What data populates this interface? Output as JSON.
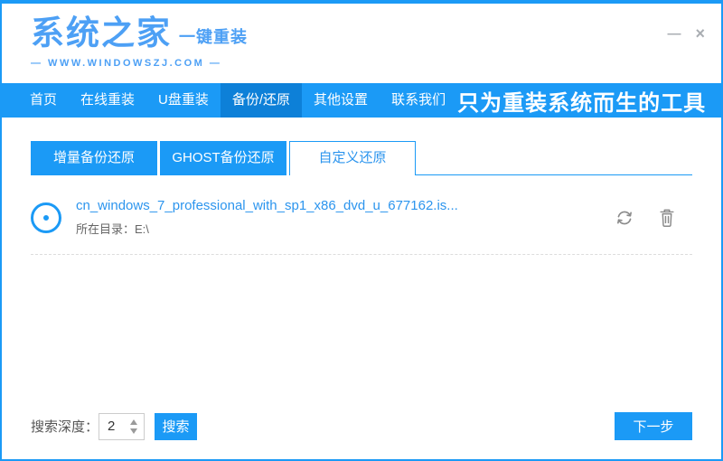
{
  "window": {
    "minimize_glyph": "—",
    "close_glyph": "×"
  },
  "header": {
    "logo_text": "系统之家",
    "logo_subtitle": "一键重装",
    "website": "—  WWW.WINDOWSZJ.COM  —"
  },
  "navbar": {
    "items": [
      {
        "label": "首页",
        "active": false
      },
      {
        "label": "在线重装",
        "active": false
      },
      {
        "label": "U盘重装",
        "active": false
      },
      {
        "label": "备份/还原",
        "active": true
      },
      {
        "label": "其他设置",
        "active": false
      },
      {
        "label": "联系我们",
        "active": false
      }
    ],
    "slogan": "只为重装系统而生的工具"
  },
  "tabs": [
    {
      "label": "增量备份还原",
      "active": false
    },
    {
      "label": "GHOST备份还原",
      "active": false
    },
    {
      "label": "自定义还原",
      "active": true
    }
  ],
  "file_list": [
    {
      "name": "cn_windows_7_professional_with_sp1_x86_dvd_u_677162.is...",
      "path": "所在目录：E:\\",
      "type_icon": "disc-icon",
      "action_icons": [
        "refresh-icon",
        "trash-icon"
      ]
    }
  ],
  "footer": {
    "depth_label": "搜索深度：",
    "depth_value": "2",
    "search_label": "搜索",
    "next_label": "下一步"
  },
  "colors": {
    "primary_blue": "#1b9af6",
    "nav_active_blue": "#0d80d8",
    "logo_blue": "#4da0f5",
    "link_blue": "#2c95ee",
    "icon_gray": "#8a8a8a",
    "divider_gray": "#dddddd",
    "window_control_gray": "#a9adb2"
  }
}
